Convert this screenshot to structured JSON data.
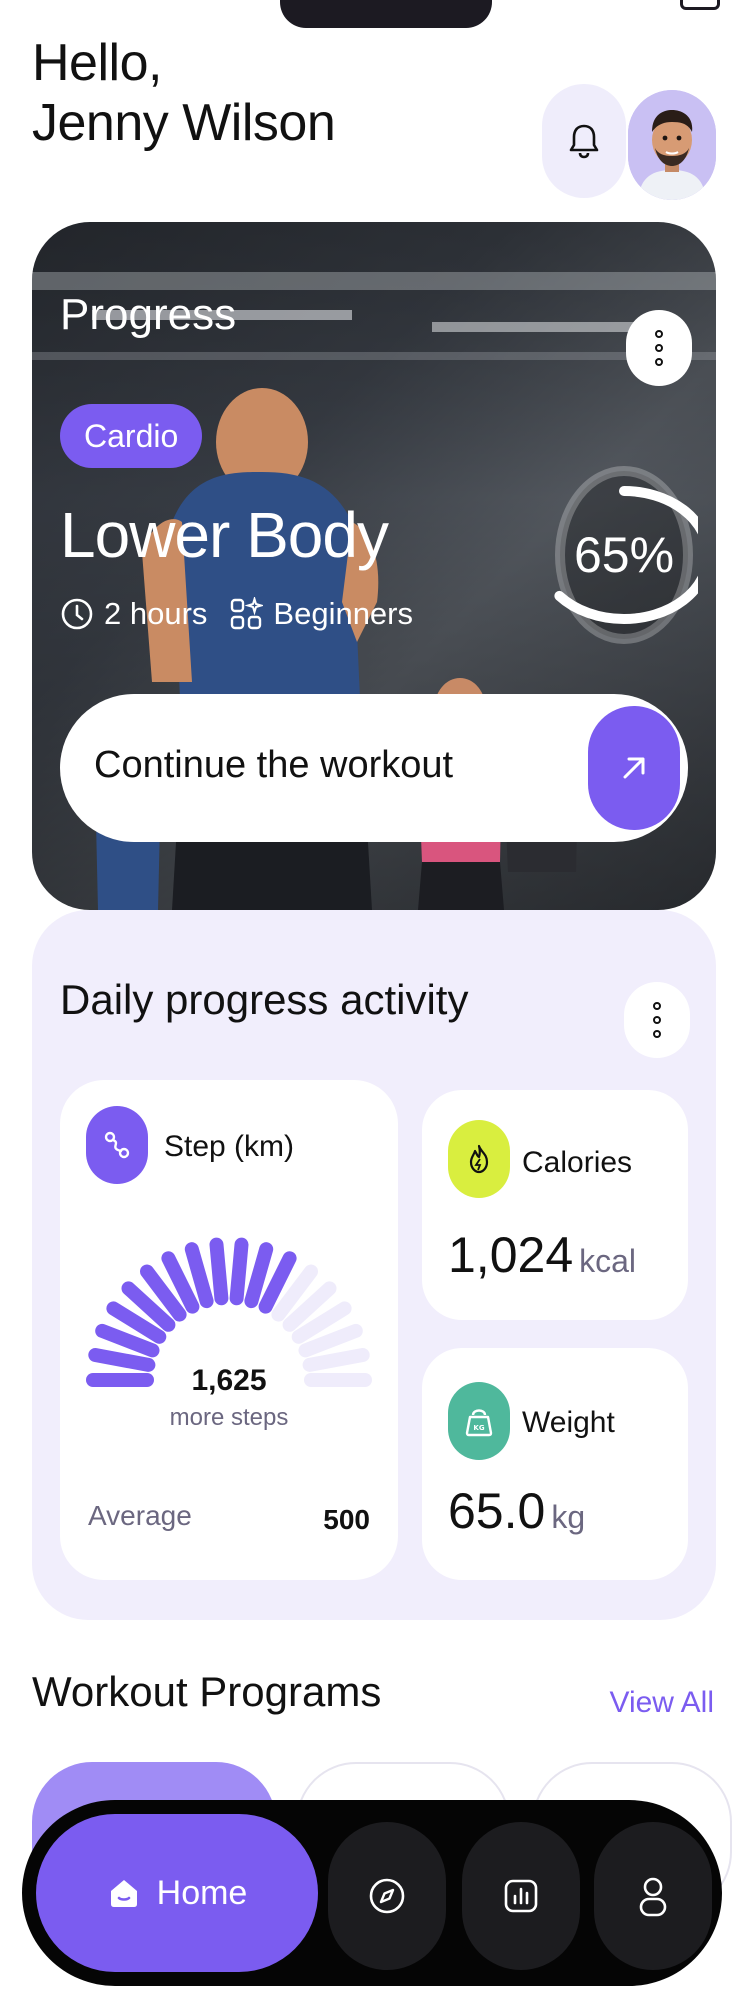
{
  "greeting": {
    "hello": "Hello,",
    "name": "Jenny Wilson"
  },
  "header": {
    "notification_icon": "bell-icon",
    "avatar": "user-avatar"
  },
  "progress_card": {
    "title": "Progress",
    "tag": "Cardio",
    "workout": "Lower Body",
    "duration": "2 hours",
    "level": "Beginners",
    "percent_label": "65%",
    "percent": 65,
    "cta": "Continue the workout"
  },
  "daily": {
    "title": "Daily progress activity",
    "steps": {
      "label": "Step (km)",
      "value": "1,625",
      "sub": "more steps",
      "avg_label": "Average",
      "avg_value": "500",
      "filled_fraction": 0.68
    },
    "calories": {
      "label": "Calories",
      "value": "1,024",
      "unit": "kcal"
    },
    "weight": {
      "label": "Weight",
      "value": "65.0",
      "unit": "kg",
      "badge": "KG"
    }
  },
  "programs": {
    "title": "Workout Programs",
    "view_all": "View All"
  },
  "nav": {
    "home": "Home"
  },
  "colors": {
    "accent": "#7b5cf0",
    "lime": "#d9ee3f",
    "teal": "#4fb89c",
    "lavender": "#f1eefc"
  }
}
